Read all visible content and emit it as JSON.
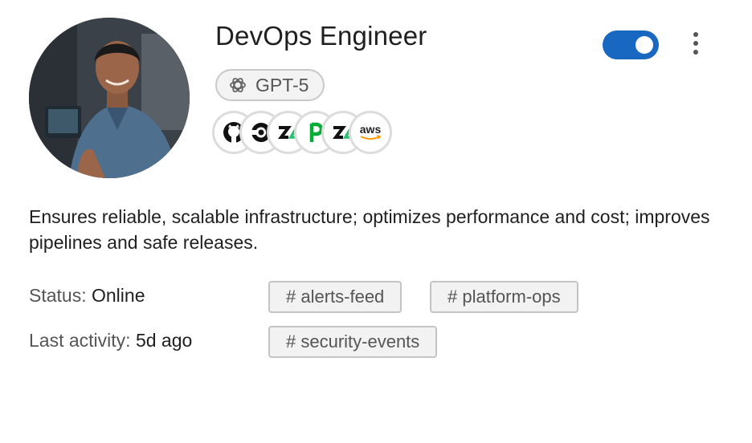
{
  "agent": {
    "title": "DevOps Engineer",
    "enabled": true,
    "model": "GPT-5",
    "description": "Ensures reliable, scalable infrastructure; optimizes performance and cost; improves pipelines and safe releases."
  },
  "integrations": [
    {
      "name": "github-icon"
    },
    {
      "name": "circleci-icon"
    },
    {
      "name": "zapier-icon"
    },
    {
      "name": "pagerduty-icon"
    },
    {
      "name": "zapier-icon"
    },
    {
      "name": "aws-icon",
      "label": "aws"
    }
  ],
  "status": {
    "label": "Status:",
    "value": "Online"
  },
  "last_activity": {
    "label": "Last activity:",
    "value": "5d ago"
  },
  "channels": [
    "# alerts-feed",
    "# platform-ops",
    "# security-events"
  ],
  "colors": {
    "toggle_on": "#1867c0",
    "aws_smile": "#ff9900",
    "pagerduty_green": "#06ac38"
  }
}
